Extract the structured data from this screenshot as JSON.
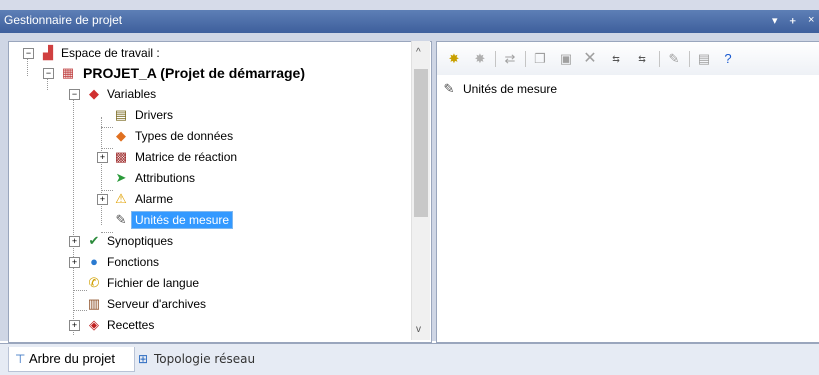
{
  "window": {
    "title": "Gestionnaire de projet",
    "controls": [
      "▾",
      "ᚐ",
      "×"
    ]
  },
  "tree": {
    "items": [
      {
        "label": "Espace de travail :",
        "icon": "workspace-icon"
      },
      {
        "label": "PROJET_A (Projet de démarrage)",
        "icon": "project-icon"
      },
      {
        "label": "Variables",
        "icon": "variables-icon"
      },
      {
        "label": "Drivers",
        "icon": "drivers-icon"
      },
      {
        "label": "Types de données",
        "icon": "data-types-icon"
      },
      {
        "label": "Matrice de réaction",
        "icon": "reaction-matrix-icon"
      },
      {
        "label": "Attributions",
        "icon": "attributions-icon"
      },
      {
        "label": "Alarme",
        "icon": "alarm-icon"
      },
      {
        "label": "Unités de mesure",
        "icon": "units-icon",
        "selected": true
      },
      {
        "label": "Synoptiques",
        "icon": "synoptics-icon"
      },
      {
        "label": "Fonctions",
        "icon": "functions-icon"
      },
      {
        "label": "Fichier de langue",
        "icon": "language-file-icon"
      },
      {
        "label": "Serveur d'archives",
        "icon": "archive-server-icon"
      },
      {
        "label": "Recettes",
        "icon": "recipes-icon"
      }
    ]
  },
  "detail": {
    "items": [
      {
        "label": "Unités de mesure",
        "icon": "units-icon"
      }
    ]
  },
  "tabs": [
    {
      "label": "Arbre du projet",
      "active": true
    },
    {
      "label": "Topologie réseau",
      "active": false
    }
  ],
  "colors": {
    "title_bar": "#4a6aa5",
    "selection": "#3399ff",
    "frame": "#cfd6e5"
  }
}
